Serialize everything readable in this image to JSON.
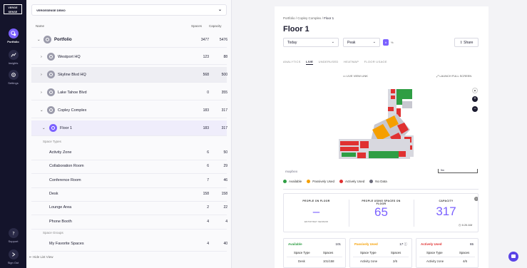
{
  "brand": {
    "logo_line1": "VERGE",
    "logo_line2": "SENSE"
  },
  "nav": [
    {
      "key": "portfolio",
      "label": "Portfolio",
      "icon": "portfolio-icon",
      "active": true
    },
    {
      "key": "insights",
      "label": "Insights",
      "icon": "insights-icon",
      "active": false
    },
    {
      "key": "settings",
      "label": "Settings",
      "icon": "settings-icon",
      "active": false
    },
    {
      "key": "support",
      "label": "Support",
      "icon": "support-icon",
      "active": false
    },
    {
      "key": "signout",
      "label": "Sign Out",
      "icon": "sign-out-icon",
      "active": false
    }
  ],
  "list": {
    "org_select": "VERGESENSE DEMO",
    "headers": {
      "name": "Name",
      "spaces": "Spaces",
      "capacity": "Capacity"
    },
    "portfolio": {
      "label": "Portfolio",
      "spaces": "3477",
      "capacity": "5476"
    },
    "buildings": [
      {
        "label": "Westport HQ",
        "spaces": "123",
        "capacity": "88"
      },
      {
        "label": "Skyline Blvd HQ",
        "spaces": "568",
        "capacity": "500"
      },
      {
        "label": "Lake Tahoe Blvd",
        "spaces": "0",
        "capacity": "355"
      },
      {
        "label": "Copley Complex",
        "spaces": "183",
        "capacity": "317"
      }
    ],
    "floor": {
      "label": "Floor 1",
      "spaces": "183",
      "capacity": "317"
    },
    "space_types_label": "Space Types",
    "space_types": [
      {
        "label": "Activity Zone",
        "spaces": "6",
        "capacity": "50"
      },
      {
        "label": "Collaboration Room",
        "spaces": "6",
        "capacity": "29"
      },
      {
        "label": "Conference Room",
        "spaces": "7",
        "capacity": "46"
      },
      {
        "label": "Desk",
        "spaces": "158",
        "capacity": "158"
      },
      {
        "label": "Lounge Area",
        "spaces": "2",
        "capacity": "22"
      },
      {
        "label": "Phone Booth",
        "spaces": "4",
        "capacity": "4"
      }
    ],
    "space_groups_label": "Space Groups",
    "space_groups": [
      {
        "label": "My Favorite Spaces",
        "spaces": "4",
        "capacity": "40"
      }
    ],
    "hide_list": "Hide List View"
  },
  "main": {
    "breadcrumb": [
      "Portfolio",
      "Copley Complex",
      "Floor 1"
    ],
    "title": "Floor 1",
    "date_select": "Today",
    "metric_select": "Peak",
    "toggle_on": "#",
    "toggle_off": "%",
    "share": "Share",
    "tabs": [
      "ANALYTICS",
      "LIVE",
      "UNDERUSED",
      "HEATMAP",
      "FLOOR USAGE"
    ],
    "active_tab": "LIVE",
    "live_view_link": "LIVE VIEW LINK",
    "launch_full_screen": "LAUNCH FULL SCREEN",
    "map_logo": "mapbox",
    "scale_label": "5m",
    "legend": [
      {
        "label": "Available",
        "color": "#2f9e44"
      },
      {
        "label": "Passively Used",
        "color": "#f59f00"
      },
      {
        "label": "Actively Used",
        "color": "#e03131"
      },
      {
        "label": "No Data",
        "color": "#6b6b7b"
      }
    ],
    "stats": {
      "people_on_floor": {
        "label": "PEOPLE ON FLOOR",
        "value": "–",
        "sub": "ENTRYWAY SENSOR"
      },
      "people_using": {
        "label": "PEOPLE USING SPACES ON FLOOR",
        "value": "65"
      },
      "capacity": {
        "label": "CAPACITY",
        "value": "317"
      },
      "time": "6:26 AM"
    },
    "boxes": [
      {
        "title": "Available",
        "color": "#2f9e44",
        "count": "101",
        "col1": "Space Type",
        "col2": "Spaces",
        "row_type": "Desk",
        "row_val": "101/158"
      },
      {
        "title": "Passively Used",
        "color": "#f59f00",
        "count": "17",
        "col1": "Space Type",
        "col2": "Spaces",
        "row_type": "Activity zone",
        "row_val": "2/6"
      },
      {
        "title": "Actively Used",
        "color": "#e03131",
        "count": "65",
        "col1": "Space Type",
        "col2": "Spaces",
        "row_type": "Activity zone",
        "row_val": "4/6"
      }
    ]
  }
}
